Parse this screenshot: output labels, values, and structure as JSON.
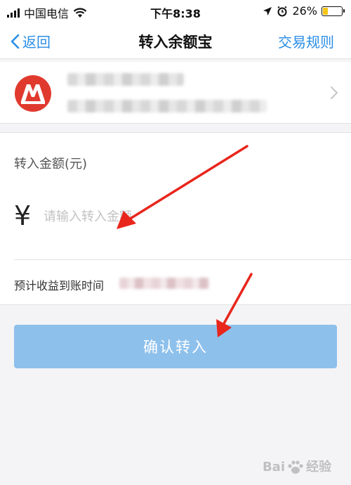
{
  "status_bar": {
    "carrier": "中国电信",
    "time": "下午8:38",
    "battery_percent": "26%",
    "battery_level": 0.26,
    "battery_color": "#f5c518"
  },
  "nav": {
    "back_label": "返回",
    "title": "转入余额宝",
    "rules_label": "交易规则",
    "accent_color": "#2a8ee6"
  },
  "card": {
    "logo": "bank-logo-icon",
    "logo_color": "#e03a2f"
  },
  "amount": {
    "label": "转入金额(元)",
    "currency_symbol": "¥",
    "placeholder": "请输入转入金额"
  },
  "arrival": {
    "label": "预计收益到账时间"
  },
  "confirm": {
    "label": "确认转入",
    "color": "#8ec0ec"
  },
  "watermark": {
    "text_left": "Bai",
    "text_right": "经验"
  }
}
